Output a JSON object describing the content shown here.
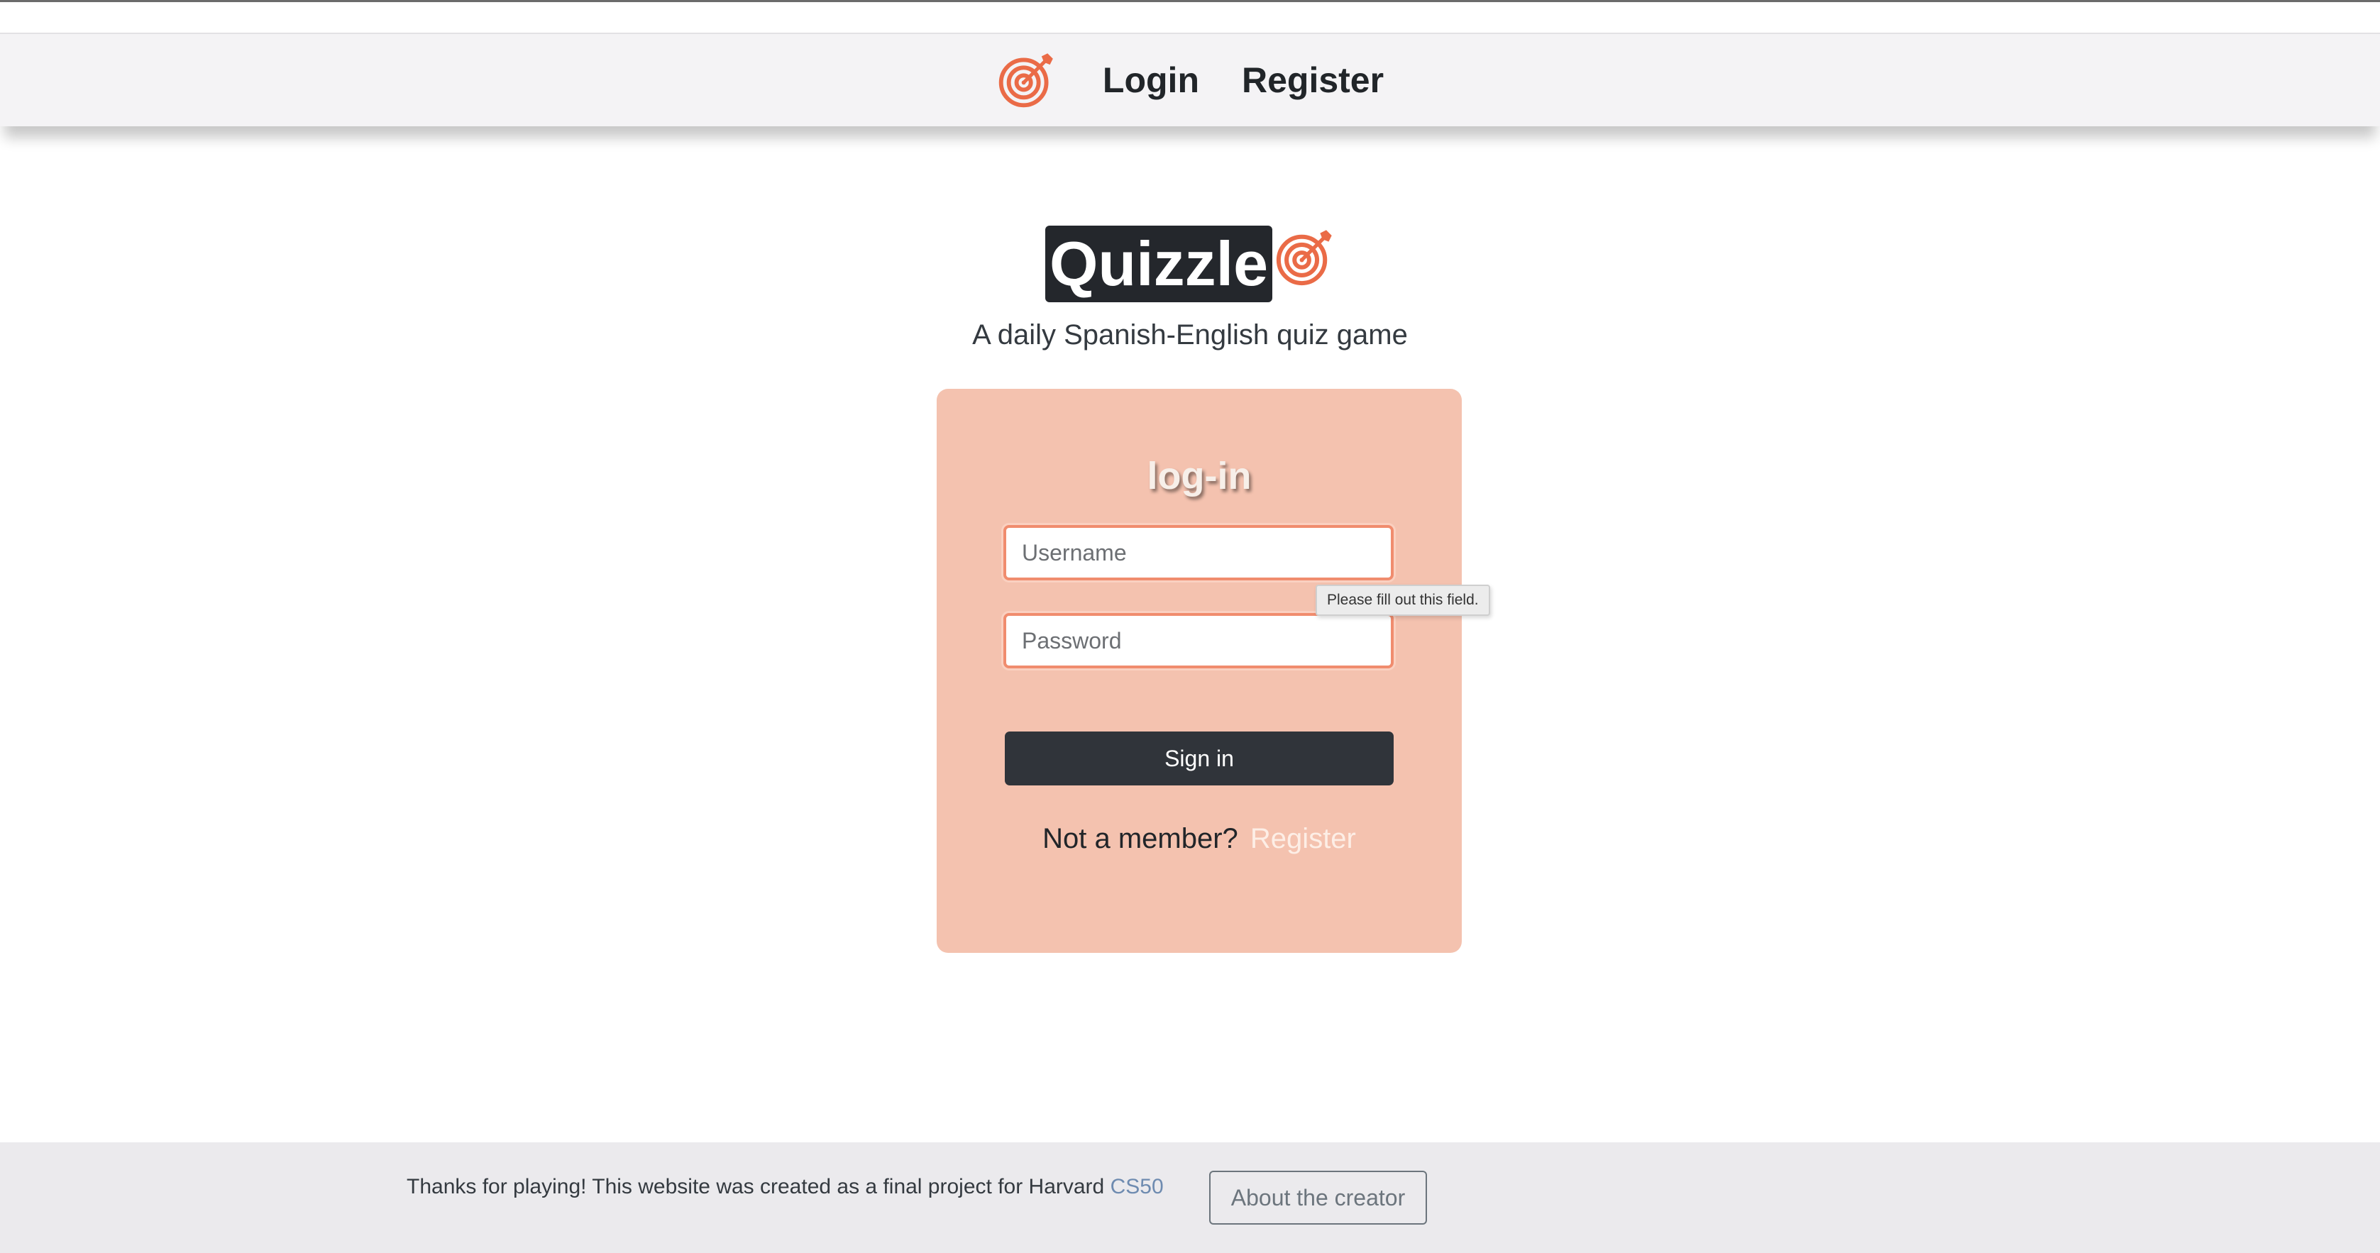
{
  "nav": {
    "logo_icon": "target-dart-icon",
    "login_label": "Login",
    "register_label": "Register"
  },
  "brand": {
    "title": "Quizzle",
    "logo_icon": "target-dart-icon",
    "tagline": "A daily Spanish-English quiz game"
  },
  "login": {
    "heading": "log-in",
    "username_placeholder": "Username",
    "username_value": "",
    "password_placeholder": "Password",
    "password_value": "",
    "validation_tooltip": "Please fill out this field.",
    "signin_label": "Sign in",
    "not_member_text": "Not a member?",
    "register_link": "Register"
  },
  "footer": {
    "text": "Thanks for playing! This website was created as a final project for Harvard",
    "link": "CS50",
    "about_button": "About the creator"
  },
  "colors": {
    "accent": "#ea6b47",
    "card_background": "#f4c2af",
    "dark": "#24272c",
    "link_footer": "#6e8bb0"
  }
}
